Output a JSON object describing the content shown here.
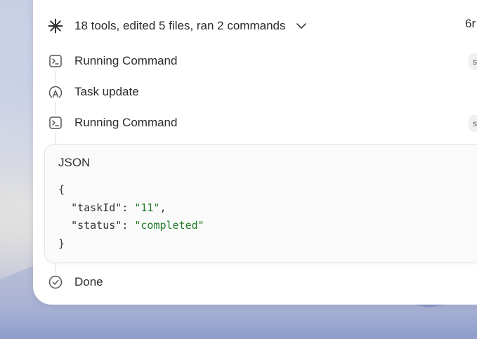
{
  "header": {
    "summary": "18 tools, edited 5 files, ran 2 commands",
    "duration_partial": "6r"
  },
  "steps": [
    {
      "label": "Running Command",
      "icon": "terminal-icon",
      "pill": "s"
    },
    {
      "label": "Task update",
      "icon": "task-update-icon"
    },
    {
      "label": "Running Command",
      "icon": "terminal-icon",
      "pill": "s"
    }
  ],
  "json_output": {
    "title": "JSON",
    "lines": {
      "open": "{",
      "key1": "\"taskId\"",
      "val1": "\"11\"",
      "key2": "\"status\"",
      "val2": "\"completed\"",
      "close": "}"
    }
  },
  "done": {
    "label": "Done",
    "icon": "check-circle-icon"
  },
  "colors": {
    "string_literal": "#1f7a28",
    "text": "#2c2c2c",
    "timeline": "#d9d9d9"
  }
}
